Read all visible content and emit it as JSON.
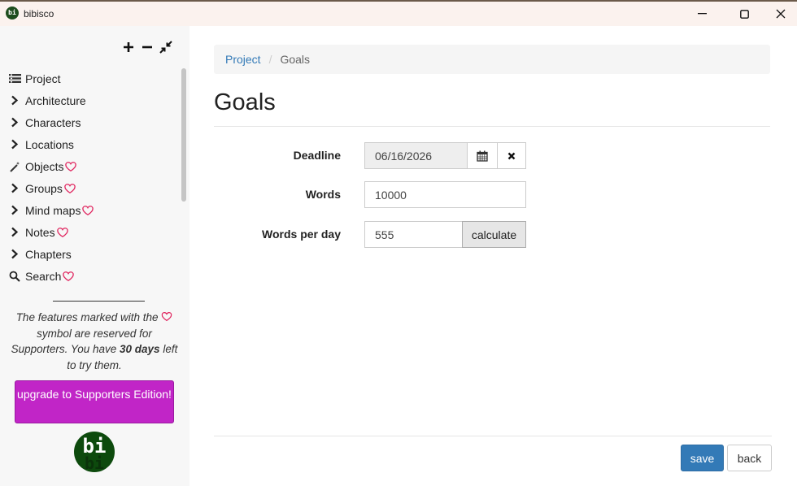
{
  "window": {
    "title": "bibisco",
    "logo_text": "bi",
    "minimize_glyph": "—",
    "maximize_glyph": "☐",
    "close_glyph": "✕"
  },
  "sidebar": {
    "tools": [
      {
        "name": "expand-all-icon",
        "glyph": "+"
      },
      {
        "name": "collapse-all-icon",
        "glyph": "−"
      },
      {
        "name": "shrink-icon",
        "glyph": "⤡"
      }
    ],
    "items": [
      {
        "label": "Project",
        "icon": "list-icon",
        "supporter": false
      },
      {
        "label": "Architecture",
        "icon": "chevron-right-icon",
        "supporter": false
      },
      {
        "label": "Characters",
        "icon": "chevron-right-icon",
        "supporter": false
      },
      {
        "label": "Locations",
        "icon": "chevron-right-icon",
        "supporter": false
      },
      {
        "label": "Objects",
        "icon": "magic-wand-icon",
        "supporter": true
      },
      {
        "label": "Groups",
        "icon": "chevron-right-icon",
        "supporter": true
      },
      {
        "label": "Mind maps",
        "icon": "chevron-right-icon",
        "supporter": true
      },
      {
        "label": "Notes",
        "icon": "chevron-right-icon",
        "supporter": true
      },
      {
        "label": "Chapters",
        "icon": "chevron-right-icon",
        "supporter": false
      },
      {
        "label": "Search",
        "icon": "search-icon",
        "supporter": true
      }
    ],
    "info_prefix": "The features marked with the",
    "info_mid": "symbol are reserved for Supporters. You have",
    "info_days": "30 days",
    "info_suffix": "left to try them.",
    "upgrade_label": "upgrade to Supporters Edition!",
    "logo_text": "bi",
    "heart_color": "#e0245e"
  },
  "breadcrumb": {
    "root": "Project",
    "separator": "/",
    "current": "Goals"
  },
  "page": {
    "title": "Goals"
  },
  "form": {
    "deadline_label": "Deadline",
    "deadline_value": "06/16/2026",
    "words_label": "Words",
    "words_value": "10000",
    "words_per_day_label": "Words per day",
    "words_per_day_value": "555",
    "calculate_label": "calculate"
  },
  "footer": {
    "save_label": "save",
    "back_label": "back"
  },
  "colors": {
    "primary": "#337ab7",
    "upgrade": "#c125c7",
    "sidebar_bg": "#f7f7f7"
  }
}
